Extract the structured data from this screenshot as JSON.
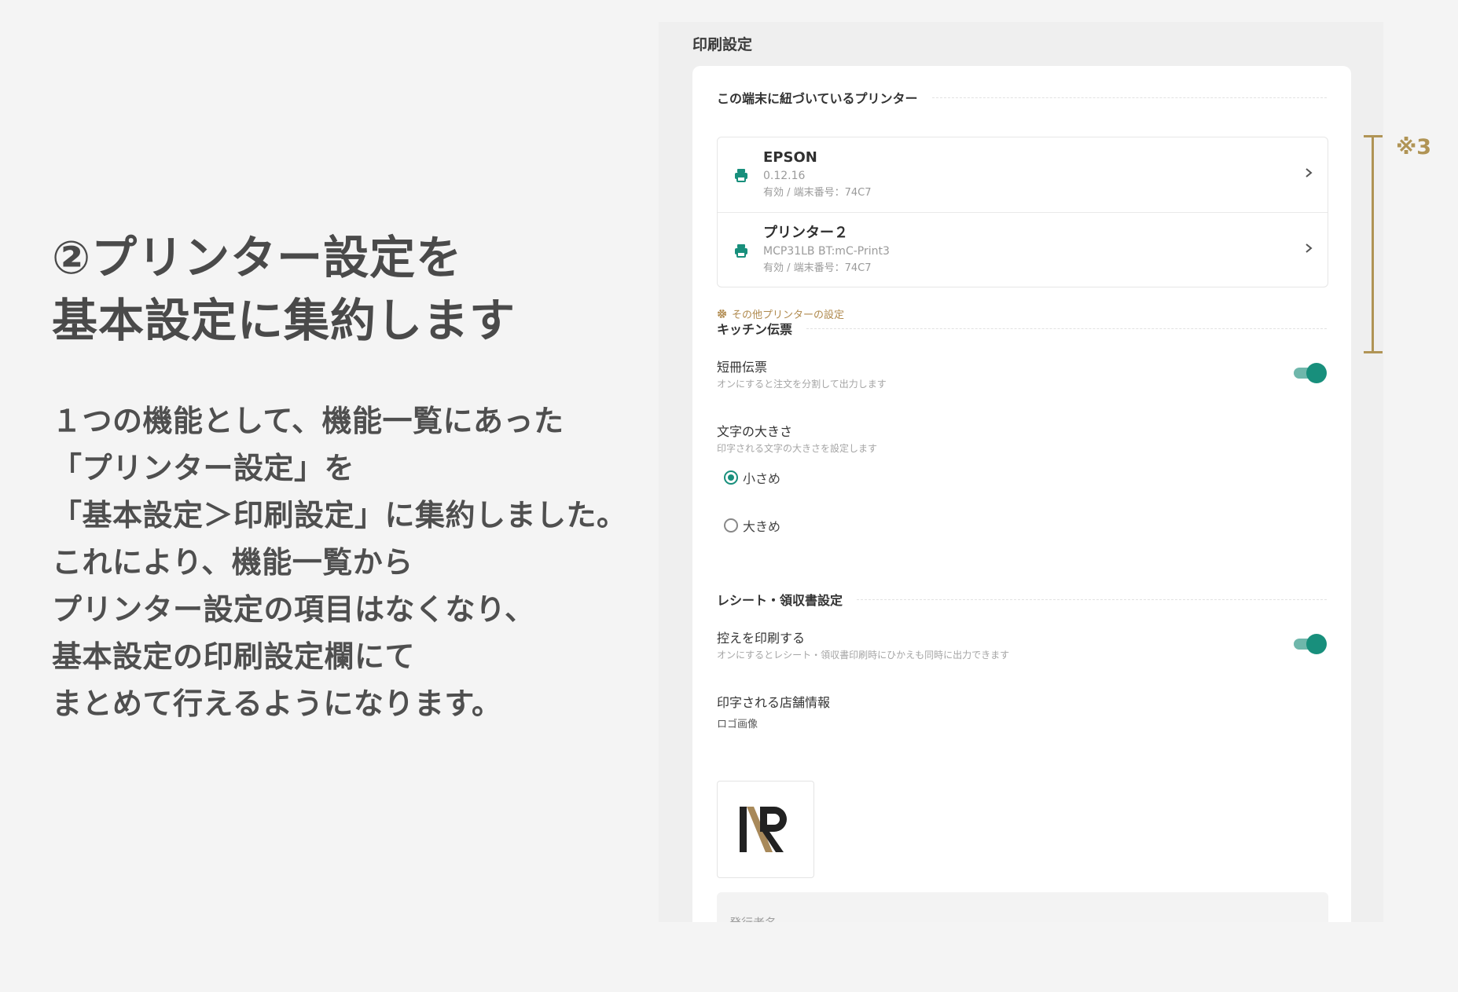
{
  "explain": {
    "headline": [
      "②プリンター設定を",
      "基本設定に集約します"
    ],
    "body": [
      "１つの機能として、機能一覧にあった",
      "「プリンター設定」を",
      "「基本設定＞印刷設定」に集約しました。",
      "これにより、機能一覧から",
      "プリンター設定の項目はなくなり、",
      "基本設定の印刷設定欄にて",
      "まとめて行えるようになります。"
    ]
  },
  "note_mark": "※3",
  "panel": {
    "title": "印刷設定",
    "printers_section": "この端末に紐づいているプリンター",
    "printers": [
      {
        "name": "EPSON",
        "model": "0.12.16",
        "status": "有効 / 端末番号：74C7",
        "icon": "printer-icon"
      },
      {
        "name": "プリンター２",
        "model": "MCP31LB BT:mC-Print3",
        "status": "有効 / 端末番号：74C7",
        "icon": "printer-icon"
      }
    ],
    "other_printer_link": "その他プリンターの設定",
    "kitchen_section": "キッチン伝票",
    "tanzaku": {
      "label": "短冊伝票",
      "sub": "オンにすると注文を分割して出力します",
      "on": true
    },
    "font_size": {
      "label": "文字の大きさ",
      "sub": "印字される文字の大きさを設定します",
      "options": [
        "小さめ",
        "大きめ"
      ],
      "selected": "小さめ"
    },
    "receipt_section": "レシート・領収書設定",
    "copy_print": {
      "label": "控えを印刷する",
      "sub": "オンにするとレシート・領収書印刷時にひかえも同時に出力できます",
      "on": true
    },
    "store_info": {
      "label": "印字される店舗情報",
      "logo_label": "ロゴ画像"
    },
    "issuer": {
      "placeholder": "発行者名"
    }
  },
  "colors": {
    "accent": "#188f7c",
    "gold": "#b09455",
    "link": "#b08a4e"
  }
}
